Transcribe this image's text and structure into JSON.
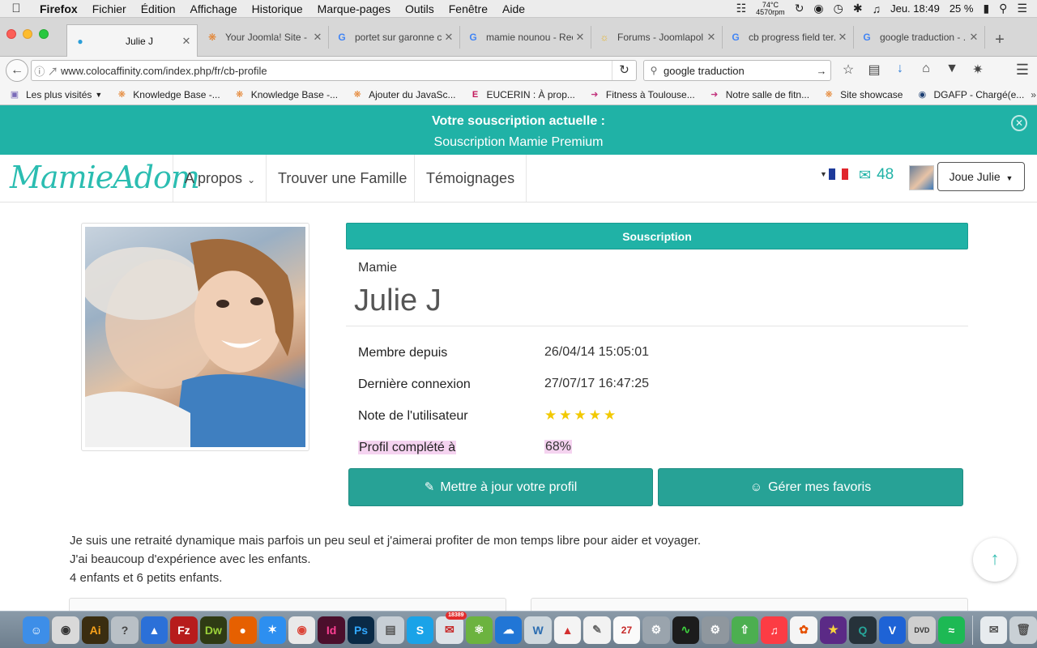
{
  "menubar": {
    "app": "Firefox",
    "items": [
      "Fichier",
      "Édition",
      "Affichage",
      "Historique",
      "Marque-pages",
      "Outils",
      "Fenêtre",
      "Aide"
    ],
    "temp_line1": "74°C",
    "temp_line2": "4570rpm",
    "clock": "Jeu. 18:49",
    "battery": "25 %"
  },
  "tabs": [
    {
      "label": "Julie J",
      "icon": "profile-icon",
      "active": true
    },
    {
      "label": "Your Joomla! Site - ...",
      "icon": "joomla-icon"
    },
    {
      "label": "portet sur garonne c...",
      "icon": "google-icon"
    },
    {
      "label": "mamie nounou - Rec...",
      "icon": "google-icon"
    },
    {
      "label": "Forums - Joomlapol...",
      "icon": "forum-icon"
    },
    {
      "label": "cb progress field ter...",
      "icon": "google-icon"
    },
    {
      "label": "google traduction - ...",
      "icon": "google-icon"
    }
  ],
  "navbar": {
    "url": "www.colocaffinity.com/index.php/fr/cb-profile",
    "search_value": "google traduction"
  },
  "bookmarks": [
    {
      "label": "Les plus visités",
      "icon": "folder-icon"
    },
    {
      "label": "Knowledge Base -...",
      "icon": "joomla-icon"
    },
    {
      "label": "Knowledge Base -...",
      "icon": "joomla-icon"
    },
    {
      "label": "Ajouter du JavaSc...",
      "icon": "joomla-icon"
    },
    {
      "label": "EUCERIN : À prop...",
      "icon": "eucerin-icon"
    },
    {
      "label": "Fitness à Toulouse...",
      "icon": "fitness-icon"
    },
    {
      "label": "Notre salle de fitn...",
      "icon": "fitness-icon"
    },
    {
      "label": "Site showcase",
      "icon": "joomla-icon"
    },
    {
      "label": "DGAFP - Chargé(e...",
      "icon": "dgafp-icon"
    }
  ],
  "notice": {
    "line1": "Votre souscription actuelle :",
    "line2": "Souscription Mamie Premium"
  },
  "header": {
    "logo": "MamieAdom",
    "nav": [
      "A propos",
      "Trouver une Famille",
      "Témoignages"
    ],
    "messages_count": "48",
    "user_button": "Joue Julie"
  },
  "profile": {
    "subscription_label": "Souscription",
    "role": "Mamie",
    "name": "Julie J",
    "fields": [
      {
        "label": "Membre depuis",
        "value": "26/04/14 15:05:01"
      },
      {
        "label": "Dernière connexion",
        "value": "27/07/17 16:47:25"
      },
      {
        "label": "Note de l'utilisateur",
        "value": ""
      },
      {
        "label": "Profil complété à",
        "value": "68%"
      }
    ],
    "rating": 5,
    "rating_max": 5,
    "update_button": "Mettre à jour votre profil",
    "favorites_button": "Gérer mes favoris",
    "description": [
      "Je suis une retraité dynamique mais parfois un peu seul et j'aimerai profiter de mon temps libre pour aider et voyager.",
      "J'ai beaucoup d'expérience avec les enfants.",
      "4 enfants et 6 petits enfants."
    ]
  },
  "dock_badge": "18389",
  "colors": {
    "teal": "#20b2a6",
    "button_teal": "#27a296",
    "star": "#f2c900",
    "highlight": "#f5d3f0"
  }
}
